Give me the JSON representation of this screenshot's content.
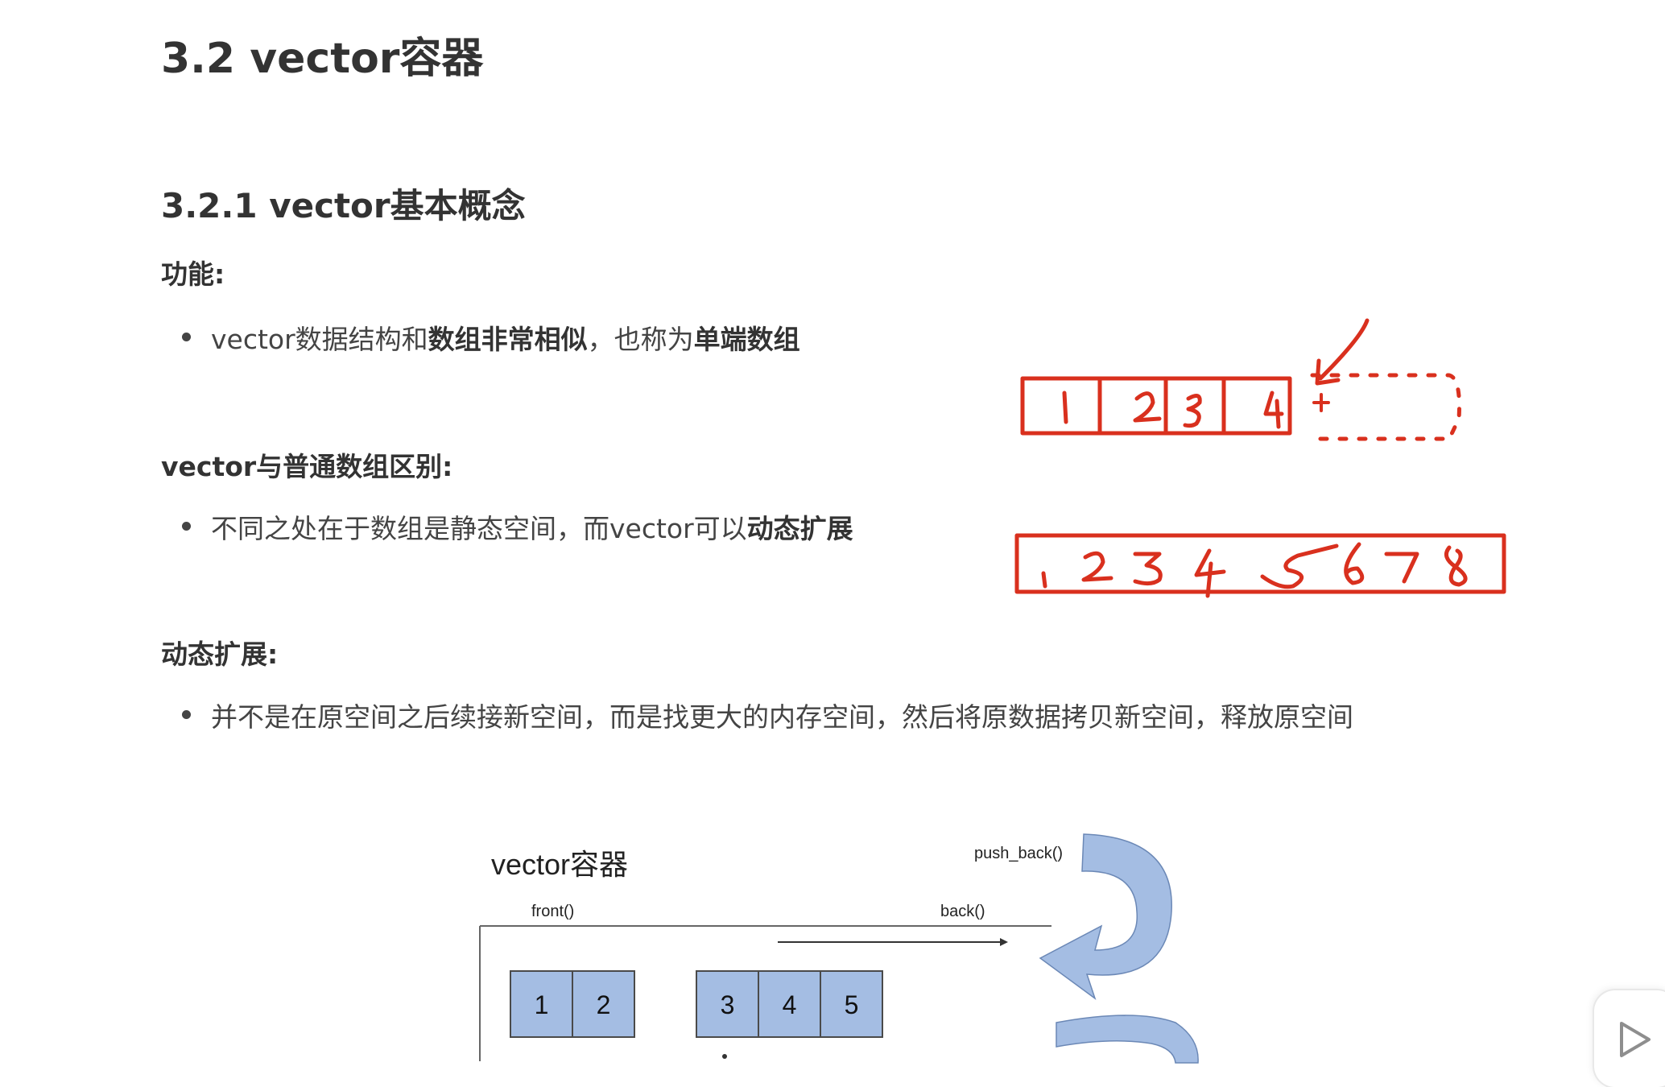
{
  "section": {
    "title": "3.2 vector容器",
    "subsection": "3.2.1 vector基本概念"
  },
  "function": {
    "heading": "功能:",
    "bullet_pre": "vector数据结构和",
    "bullet_bold1": "数组非常相似",
    "bullet_mid": "，也称为",
    "bullet_bold2": "单端数组"
  },
  "difference": {
    "heading": "vector与普通数组区别:",
    "bullet_pre": "不同之处在于数组是静态空间，而vector可以",
    "bullet_bold": "动态扩展"
  },
  "dynamic": {
    "heading": "动态扩展:",
    "bullet": "并不是在原空间之后续接新空间，而是找更大的内存空间，然后将原数据拷贝新空间，释放原空间"
  },
  "diagram": {
    "title": "vector容器",
    "front_label": "front()",
    "back_label": "back()",
    "push_back_label": "push_back()",
    "cells_left": [
      "1",
      "2"
    ],
    "cells_right": [
      "3",
      "4",
      "5"
    ],
    "cell_fill": "#a4bde3",
    "arrow_fill": "#a4bde3"
  },
  "annotation": {
    "color": "#d9301e",
    "row1_digits": [
      "1",
      "2",
      "3",
      "4"
    ],
    "row2_digits": [
      "1",
      "2",
      "3",
      "4",
      "5",
      "6",
      "7",
      "8"
    ]
  },
  "player": {
    "play_icon": "play-icon"
  }
}
